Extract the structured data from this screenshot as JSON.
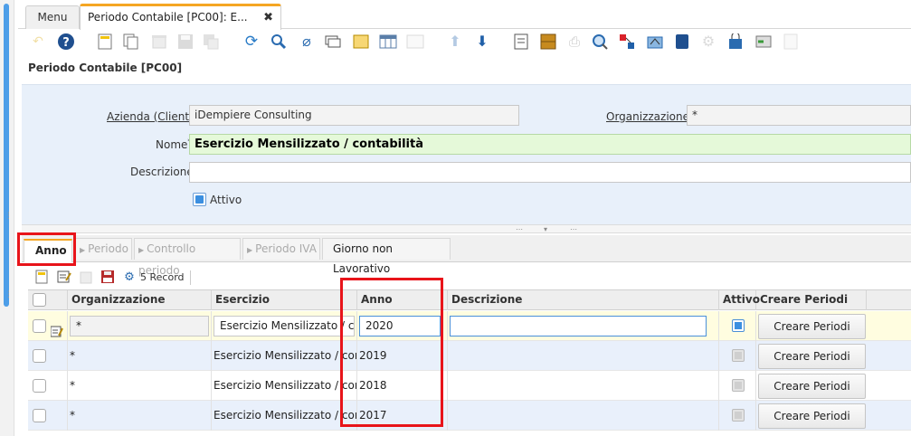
{
  "tabs": {
    "menu_label": "Menu",
    "active_label": "Periodo Contabile [PC00]: E...",
    "close_symbol": "✖"
  },
  "toolbar": {
    "icons": [
      "undo-icon",
      "help-icon",
      "new-icon",
      "copy-icon",
      "delete-icon",
      "save-icon",
      "save-new-icon",
      "refresh-icon",
      "find-icon",
      "attachment-icon",
      "chat-icon",
      "postit-icon",
      "grid-toggle-icon",
      "detail-icon",
      "previous-icon",
      "next-icon",
      "report-icon",
      "archive-icon",
      "print-icon",
      "zoom-across-icon",
      "workflow-icon",
      "process-icon",
      "export-icon",
      "import-icon",
      "lock-icon",
      "processing-icon",
      "request-icon",
      "product-info-icon",
      "customize-icon"
    ]
  },
  "window_title": "Periodo Contabile [PC00]",
  "form": {
    "client_label": "Azienda (Client)",
    "client_value": "iDempiere Consulting",
    "org_label": "Organizzazione",
    "org_value": "*",
    "name_label": "Nome",
    "name_value": "Esercizio Mensilizzato / contabilità",
    "description_label": "Descrizione",
    "description_value": "",
    "active_label": "Attivo",
    "required_mark": "*"
  },
  "detail_tabs": {
    "anno": "Anno",
    "periodo": "Periodo",
    "controllo": "Controllo periodo",
    "periodo_iva": "Periodo IVA",
    "giorno": "Giorno non Lavorativo"
  },
  "grid_toolbar": {
    "record_count": "5 Record"
  },
  "grid": {
    "headers": {
      "org": "Organizzazione",
      "esercizio": "Esercizio",
      "anno": "Anno",
      "descrizione": "Descrizione",
      "attivo": "Attivo",
      "creare": "Creare Periodi"
    },
    "rows": [
      {
        "org": "*",
        "esercizio": "Esercizio Mensilizzato / cor",
        "anno": "2020",
        "descrizione": "",
        "attivo": true,
        "button": "Creare Periodi"
      },
      {
        "org": "*",
        "esercizio": "Esercizio Mensilizzato / conta",
        "anno": "2019",
        "descrizione": "",
        "attivo": false,
        "button": "Creare Periodi"
      },
      {
        "org": "*",
        "esercizio": "Esercizio Mensilizzato / conta",
        "anno": "2018",
        "descrizione": "",
        "attivo": false,
        "button": "Creare Periodi"
      },
      {
        "org": "*",
        "esercizio": "Esercizio Mensilizzato / conta",
        "anno": "2017",
        "descrizione": "",
        "attivo": false,
        "button": "Creare Periodi"
      }
    ]
  },
  "colors": {
    "accent_tab": "#f5a623",
    "highlight_box": "#e8141a",
    "name_field_bg": "#e5f9d9",
    "form_bg": "#e8f0fa"
  }
}
